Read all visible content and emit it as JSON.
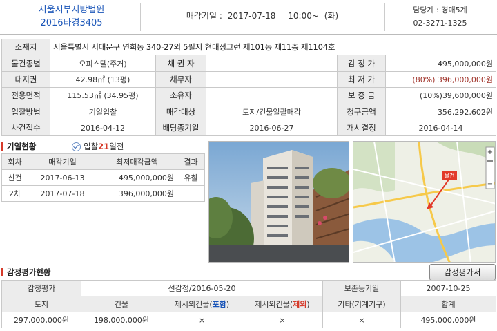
{
  "header": {
    "court_name": "서울서부지방법원",
    "case_no": "2016타경3405",
    "sale_label": "매각기일 :",
    "sale_date": "2017-07-18",
    "sale_time": "10:00~",
    "sale_day": "(화)",
    "contact_dept": "담당계 : 경매5계",
    "contact_phone": "02-3271-1325"
  },
  "info": {
    "address_label": "소재지",
    "address": "서울특별시 서대문구 연희동 340-27외 5필지 현대성그런 제101동 제11층 제1104호",
    "property_type_label": "물건종별",
    "property_type": "오피스텔(주거)",
    "creditor_label": "채 권 자",
    "creditor": "",
    "appraisal_label": "감 정 가",
    "appraisal": "495,000,000원",
    "land_right_label": "대지권",
    "land_right": "42.98㎡ (13평)",
    "debtor_label": "채무자",
    "debtor": "",
    "min_price_label": "최 저 가",
    "min_price": "(80%) 396,000,000원",
    "area_label": "전용면적",
    "area": "115.53㎡ (34.95평)",
    "owner_label": "소유자",
    "owner": "",
    "deposit_label": "보 증 금",
    "deposit": "(10%)39,600,000원",
    "bid_method_label": "입찰방법",
    "bid_method": "기일입찰",
    "sale_target_label": "매각대상",
    "sale_target": "토지/건물일괄매각",
    "claim_label": "청구금액",
    "claim": "356,292,602원",
    "case_recv_label": "사건접수",
    "case_recv": "2016-04-12",
    "dividend_label": "배당종기일",
    "dividend": "2016-06-27",
    "start_label": "개시결정",
    "start": "2016-04-14"
  },
  "history": {
    "title": "기일현황",
    "badge_pre": "입찰",
    "badge_num": "21",
    "badge_post": "일전",
    "headers": [
      "회차",
      "매각기일",
      "최저매각금액",
      "결과"
    ],
    "rows": [
      [
        "신건",
        "2017-06-13",
        "495,000,000원",
        "유찰"
      ],
      [
        "2차",
        "2017-07-18",
        "396,000,000원",
        ""
      ]
    ]
  },
  "map": {
    "marker_label": "물건"
  },
  "appraisal": {
    "title": "감정평가현황",
    "button": "감정평가서",
    "row1": {
      "label": "감정평가",
      "value": "선감정/2016-05-20",
      "reg_label": "보존등기일",
      "reg_value": "2007-10-25"
    },
    "headers": {
      "land": "토지",
      "building": "건물",
      "excl_pre": "제시외건물(",
      "incl_word": "포함",
      "excl_word": "제외",
      "excl_post": ")",
      "other": "기타(기계기구)",
      "total": "합계"
    },
    "values": {
      "land": "297,000,000원",
      "building": "198,000,000원",
      "incl": "×",
      "excl": "×",
      "other": "×",
      "total": "495,000,000원"
    }
  },
  "colors": {
    "court_blue": "#1a55b8",
    "accent_red": "#d63a2a",
    "header_gray": "#ececec"
  }
}
